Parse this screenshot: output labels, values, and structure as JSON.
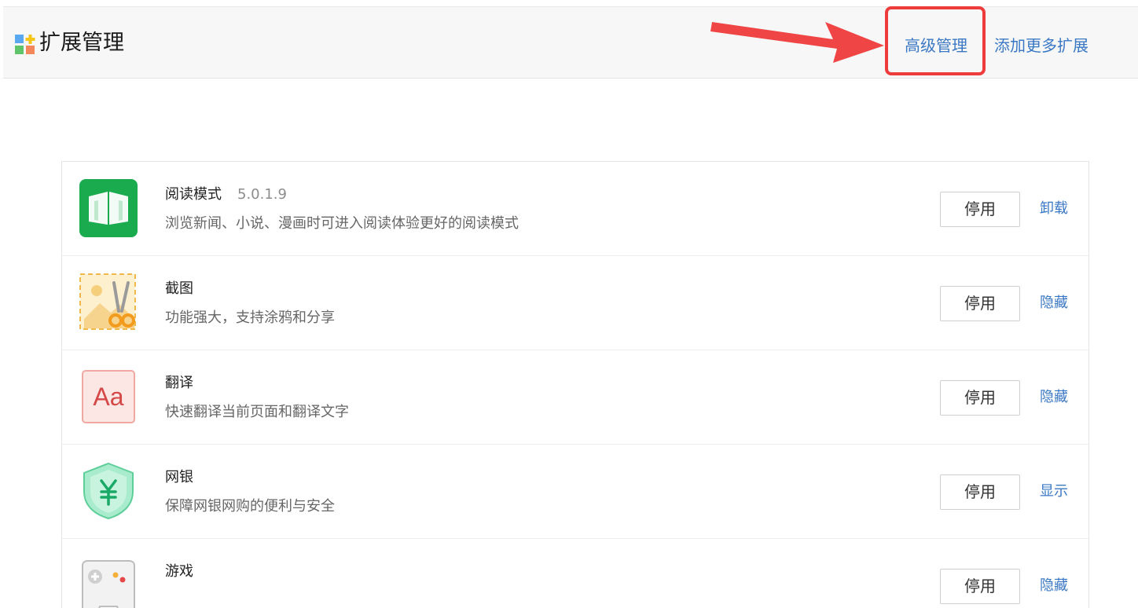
{
  "header": {
    "title": "扩展管理",
    "advanced_link": "高级管理",
    "add_more_link": "添加更多扩展"
  },
  "colors": {
    "link": "#3b78c4",
    "highlight": "#ee3b3b",
    "header_bg": "#f7f7f7"
  },
  "extensions": [
    {
      "name": "阅读模式",
      "version": "5.0.1.9",
      "desc": "浏览新闻、小说、漫画时可进入阅读体验更好的阅读模式",
      "button": "停用",
      "action": "卸载",
      "icon": "book-icon"
    },
    {
      "name": "截图",
      "version": "",
      "desc": "功能强大，支持涂鸦和分享",
      "button": "停用",
      "action": "隐藏",
      "icon": "scissors-icon"
    },
    {
      "name": "翻译",
      "version": "",
      "desc": "快速翻译当前页面和翻译文字",
      "button": "停用",
      "action": "隐藏",
      "icon": "translate-icon"
    },
    {
      "name": "网银",
      "version": "",
      "desc": "保障网银网购的便利与安全",
      "button": "停用",
      "action": "显示",
      "icon": "shield-yen-icon"
    },
    {
      "name": "游戏",
      "version": "",
      "desc": "",
      "button": "停用",
      "action": "隐藏",
      "icon": "gamepad-icon"
    }
  ]
}
